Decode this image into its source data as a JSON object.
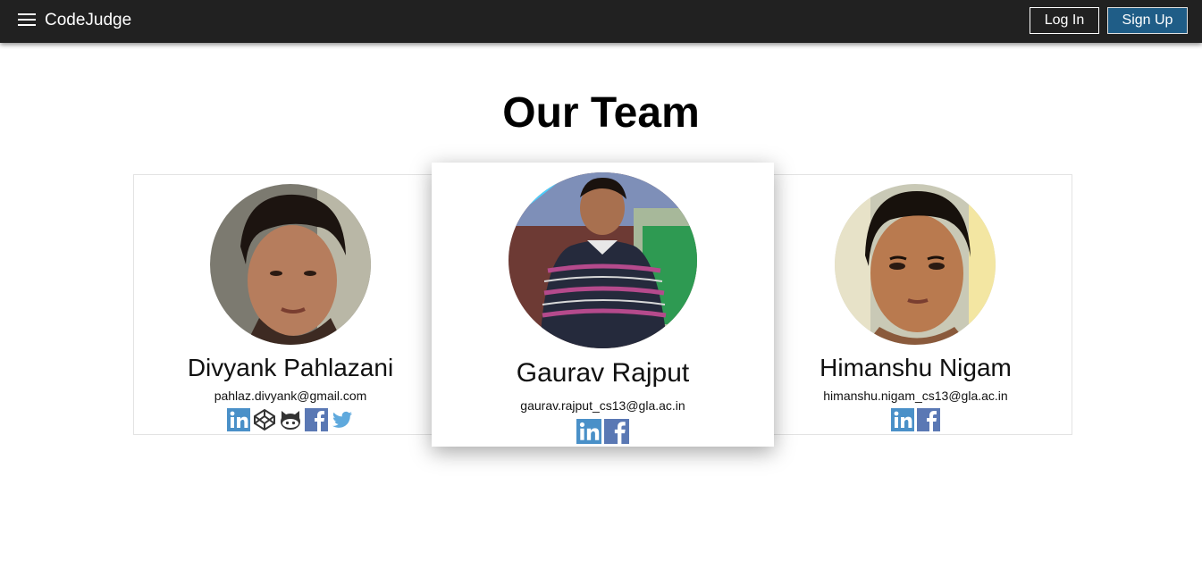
{
  "navbar": {
    "brand": "CodeJudge",
    "login_label": "Log In",
    "signup_label": "Sign Up",
    "menu_icon": "hamburger-menu-icon"
  },
  "page": {
    "title": "Our Team"
  },
  "team": [
    {
      "name": "Divyank Pahlazani",
      "email": "pahlaz.divyank@gmail.com",
      "socials": [
        "linkedin-icon",
        "codepen-icon",
        "github-icon",
        "facebook-icon",
        "twitter-icon"
      ]
    },
    {
      "name": "Gaurav Rajput",
      "email": "gaurav.rajput_cs13@gla.ac.in",
      "socials": [
        "linkedin-icon",
        "facebook-icon"
      ]
    },
    {
      "name": "Himanshu Nigam",
      "email": "himanshu.nigam_cs13@gla.ac.in",
      "socials": [
        "linkedin-icon",
        "facebook-icon"
      ]
    }
  ],
  "colors": {
    "navbar_bg": "#212121",
    "signup_bg": "#1f5d87",
    "linkedin": "#4a90c8",
    "facebook": "#5a78b4",
    "twitter": "#5fa9dd"
  }
}
